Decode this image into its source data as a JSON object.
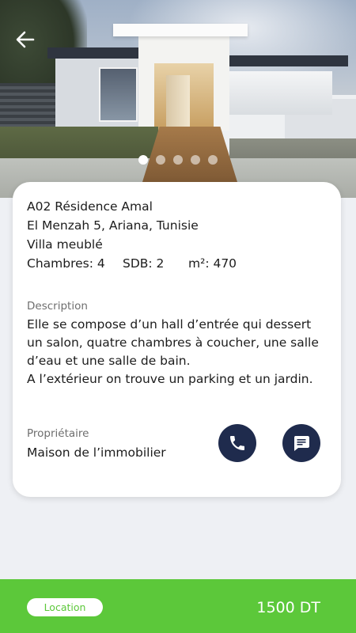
{
  "header": {
    "back_icon": "arrow-left-icon",
    "gallery": {
      "total": 5,
      "active": 0
    }
  },
  "property": {
    "title": "A02 Résidence Amal",
    "address": "El Menzah 5, Ariana, Tunisie",
    "type": "Villa meublé",
    "bedrooms": "Chambres: 4",
    "bathrooms": "SDB: 2",
    "area": "m²: 470"
  },
  "description": {
    "label": "Description",
    "lines": [
      "Elle se compose d’un hall d’entrée qui dessert un salon, quatre chambres à coucher, une salle d’eau et une salle de bain.",
      "A l’extérieur on trouve un parking et un jardin."
    ]
  },
  "owner": {
    "label": "Propriétaire",
    "name": "Maison de l’immobilier",
    "call_icon": "phone-icon",
    "message_icon": "message-icon"
  },
  "footer": {
    "tag": "Location",
    "price": "1500 DT",
    "accent_color": "#5cc83a"
  }
}
